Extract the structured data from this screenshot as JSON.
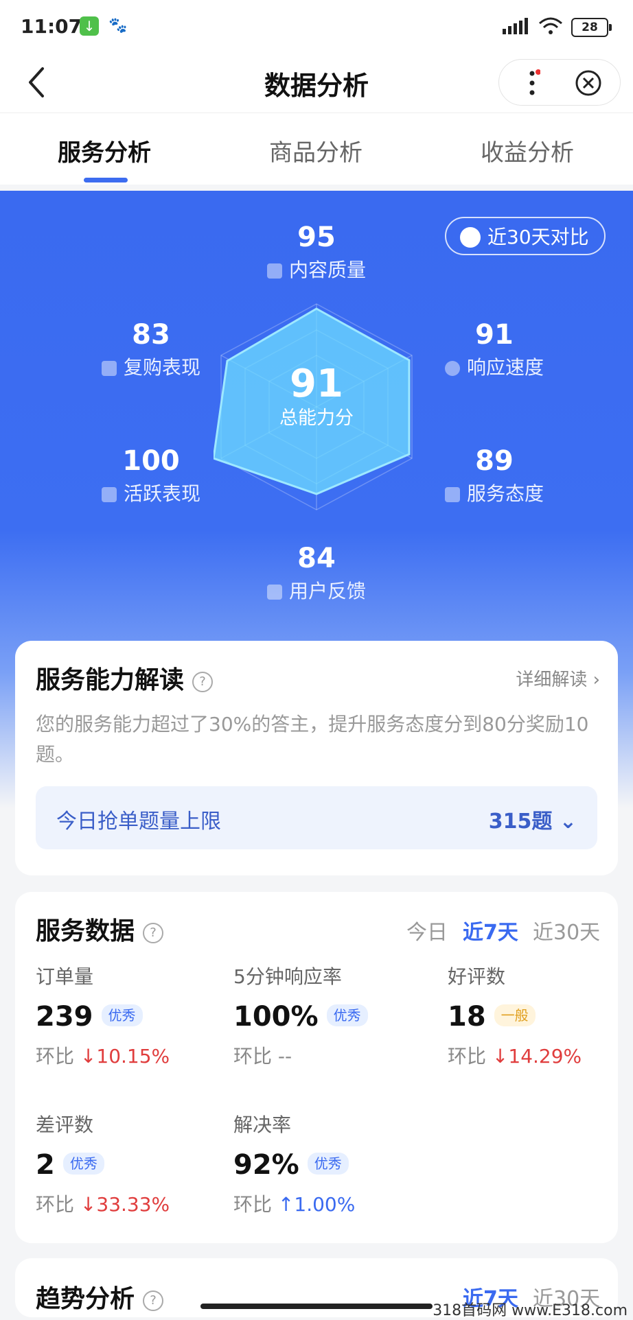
{
  "status_bar": {
    "time": "11:07",
    "battery": "28"
  },
  "nav": {
    "title": "数据分析"
  },
  "tabs": [
    {
      "label": "服务分析",
      "active": true
    },
    {
      "label": "商品分析",
      "active": false
    },
    {
      "label": "收益分析",
      "active": false
    }
  ],
  "radar": {
    "compare_label": "近30天对比",
    "total": {
      "value": "91",
      "label": "总能力分"
    },
    "dimensions": [
      {
        "value": "95",
        "label": "内容质量",
        "icon": "document-icon"
      },
      {
        "value": "91",
        "label": "响应速度",
        "icon": "clock-icon"
      },
      {
        "value": "89",
        "label": "服务态度",
        "icon": "user-icon"
      },
      {
        "value": "84",
        "label": "用户反馈",
        "icon": "feedback-icon"
      },
      {
        "value": "100",
        "label": "活跃表现",
        "icon": "flame-icon"
      },
      {
        "value": "83",
        "label": "复购表现",
        "icon": "thumbs-up-icon"
      }
    ]
  },
  "ability_card": {
    "title": "服务能力解读",
    "detail_link": "详细解读",
    "description": "您的服务能力超过了30%的答主，提升服务态度分到80分奖励10题。",
    "quota_label": "今日抢单题量上限",
    "quota_value": "315题"
  },
  "service_data": {
    "title": "服务数据",
    "periods": [
      {
        "label": "今日",
        "active": false
      },
      {
        "label": "近7天",
        "active": true
      },
      {
        "label": "近30天",
        "active": false
      }
    ],
    "metrics": [
      {
        "label": "订单量",
        "value": "239",
        "badge": "优秀",
        "badge_type": "good",
        "compare_prefix": "环比",
        "arrow": "↓",
        "change": "10.15%",
        "trend": "down"
      },
      {
        "label": "5分钟响应率",
        "value": "100%",
        "badge": "优秀",
        "badge_type": "good",
        "compare_prefix": "环比",
        "arrow": "",
        "change": "--",
        "trend": "none"
      },
      {
        "label": "好评数",
        "value": "18",
        "badge": "一般",
        "badge_type": "ok",
        "compare_prefix": "环比",
        "arrow": "↓",
        "change": "14.29%",
        "trend": "down"
      },
      {
        "label": "差评数",
        "value": "2",
        "badge": "优秀",
        "badge_type": "good",
        "compare_prefix": "环比",
        "arrow": "↓",
        "change": "33.33%",
        "trend": "down"
      },
      {
        "label": "解决率",
        "value": "92%",
        "badge": "优秀",
        "badge_type": "good",
        "compare_prefix": "环比",
        "arrow": "↑",
        "change": "1.00%",
        "trend": "up"
      }
    ]
  },
  "trend_card": {
    "title": "趋势分析",
    "periods": [
      {
        "label": "近7天",
        "active": true
      },
      {
        "label": "近30天",
        "active": false
      }
    ]
  },
  "watermark": "318首码网 www.E318.com",
  "colors": {
    "primary": "#3a6af0",
    "down": "#e03d3d"
  }
}
